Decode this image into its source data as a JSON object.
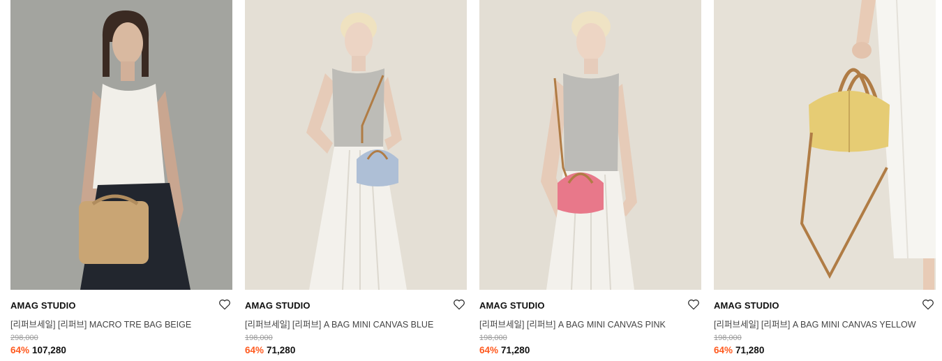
{
  "products": [
    {
      "brand": "AMAG STUDIO",
      "name": "[리퍼브세일] [리퍼브] MACRO TRE BAG BEIGE",
      "original_price": "298,000",
      "discount": "64%",
      "price": "107,280",
      "image": "model-with-beige-clutch",
      "bag_color": "#c9a574"
    },
    {
      "brand": "AMAG STUDIO",
      "name": "[리퍼브세일] [리퍼브] A BAG MINI CANVAS BLUE",
      "original_price": "198,000",
      "discount": "64%",
      "price": "71,280",
      "image": "model-with-blue-mini-bag",
      "bag_color": "#aebfd6"
    },
    {
      "brand": "AMAG STUDIO",
      "name": "[리퍼브세일] [리퍼브] A BAG MINI CANVAS PINK",
      "original_price": "198,000",
      "discount": "64%",
      "price": "71,280",
      "image": "model-with-pink-mini-bag",
      "bag_color": "#e8788a"
    },
    {
      "brand": "AMAG STUDIO",
      "name": "[리퍼브세일] [리퍼브] A BAG MINI CANVAS YELLOW",
      "original_price": "198,000",
      "discount": "64%",
      "price": "71,280",
      "image": "hand-holding-yellow-bag",
      "bag_color": "#e6cc74"
    }
  ],
  "colors": {
    "discount": "#ff5a1f",
    "brand_text": "#111111",
    "name_text": "#444444",
    "original_price_text": "#9a9a9a"
  },
  "icons": {
    "wishlist": "heart-outline-icon"
  }
}
